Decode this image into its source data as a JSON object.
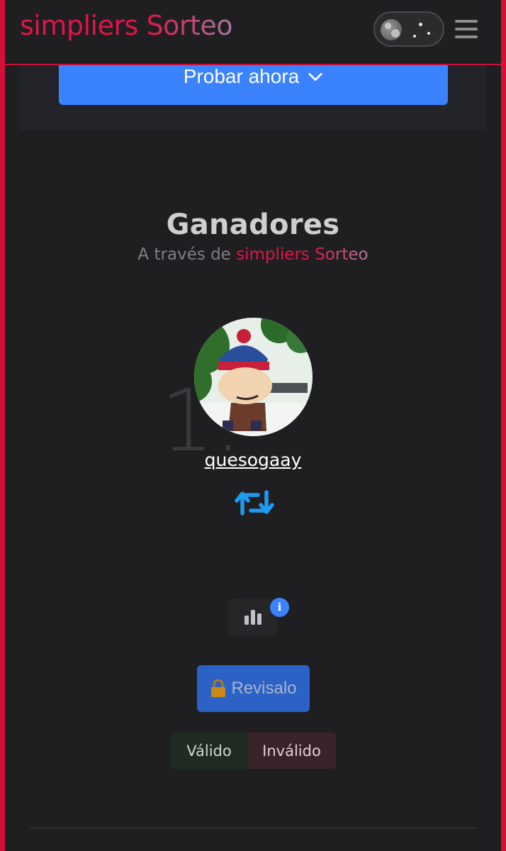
{
  "header": {
    "brand_part1": "simpliers",
    "brand_part2": "Sorteo",
    "theme_toggle": "dark",
    "menu_icon": "hamburger-icon"
  },
  "hero": {
    "try_button_label": "Probar ahora"
  },
  "winners": {
    "title": "Ganadores",
    "subtitle_prefix": "A través de",
    "subtitle_brand1": "simpliers",
    "subtitle_brand2": "Sorteo",
    "items": [
      {
        "rank": "1.",
        "username": "quesogaay",
        "action_icon": "retweet-icon"
      }
    ]
  },
  "controls": {
    "stats_icon": "bar-chart-icon",
    "info_icon": "info-icon",
    "review_label": "Revisalo",
    "valid_label": "Válido",
    "invalid_label": "Inválido"
  },
  "colors": {
    "accent_red": "#e01548",
    "primary_blue": "#3b82fe",
    "background": "#1f1f22"
  }
}
